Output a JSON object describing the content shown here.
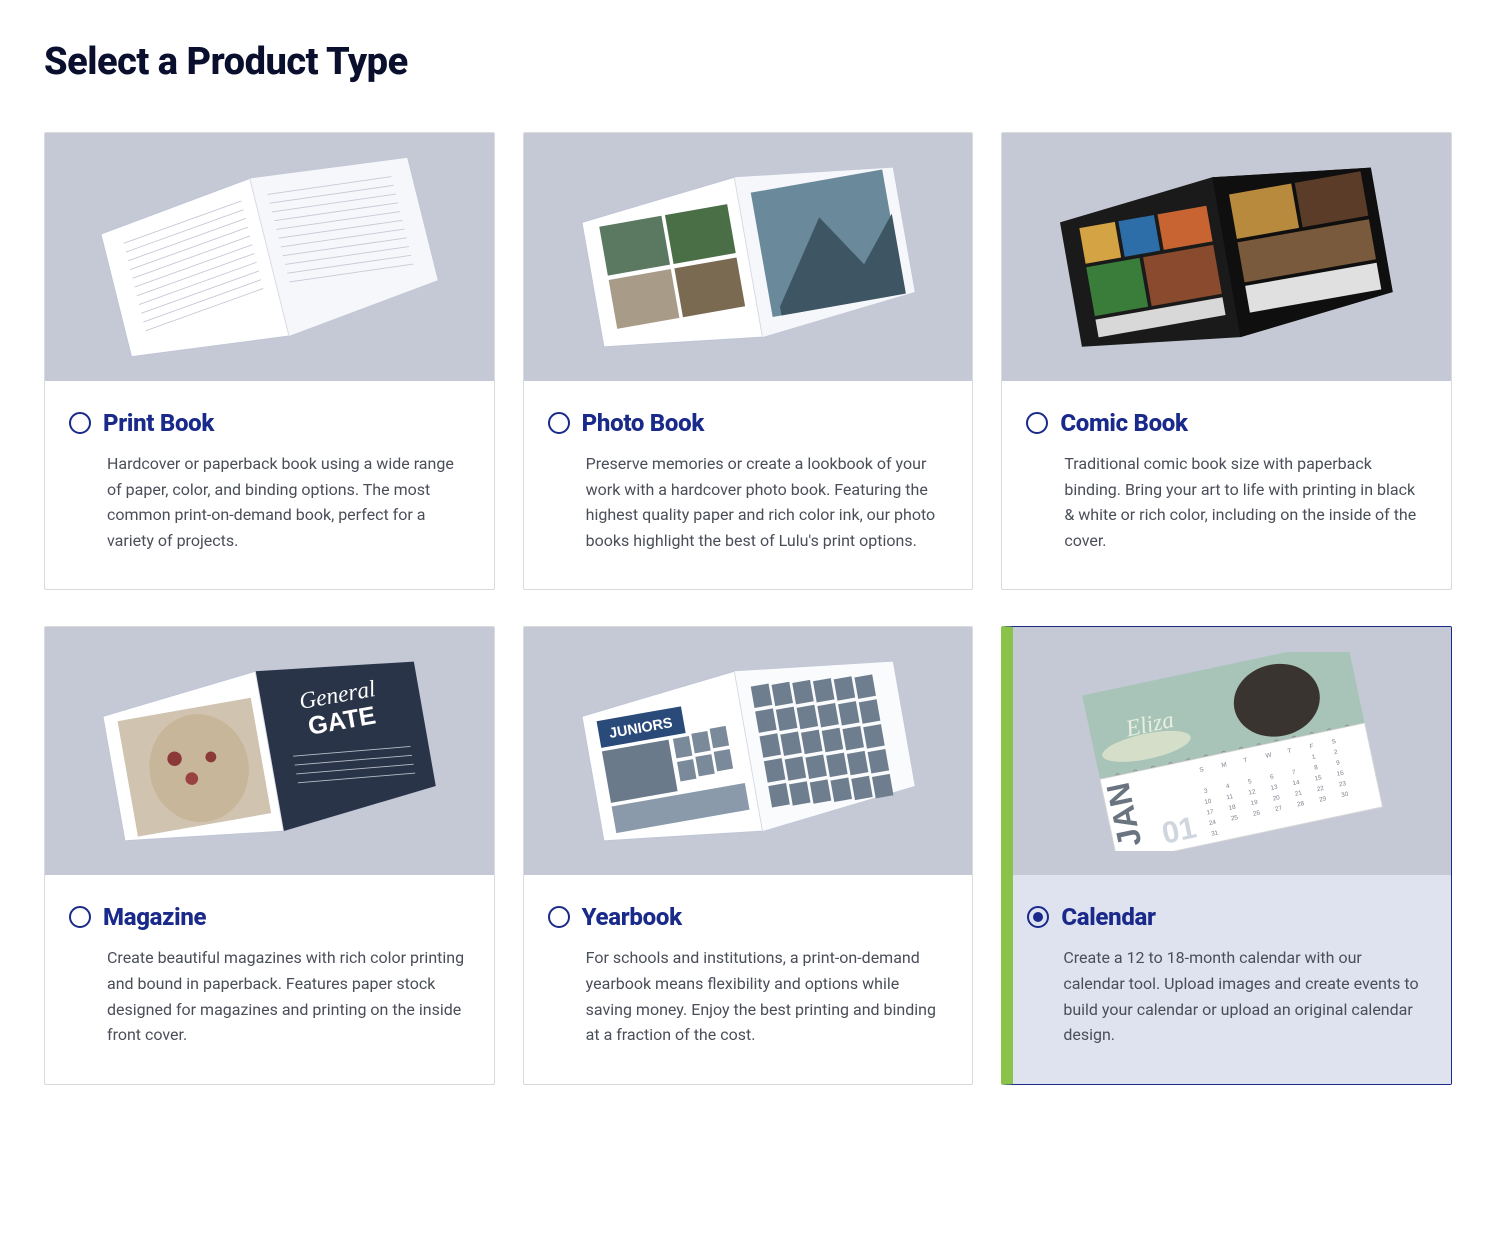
{
  "page": {
    "title": "Select a Product Type"
  },
  "products": [
    {
      "id": "print-book",
      "title": "Print Book",
      "description": "Hardcover or paperback book using a wide range of paper, color, and binding options. The most common print-on-demand book, perfect for a variety of projects.",
      "selected": false
    },
    {
      "id": "photo-book",
      "title": "Photo Book",
      "description": "Preserve memories or create a lookbook of your work with a hardcover photo book. Featuring the highest quality paper and rich color ink, our photo books highlight the best of Lulu's print options.",
      "selected": false
    },
    {
      "id": "comic-book",
      "title": "Comic Book",
      "description": "Traditional comic book size with paperback binding. Bring your art to life with printing in black & white or rich color, including on the inside of the cover.",
      "selected": false
    },
    {
      "id": "magazine",
      "title": "Magazine",
      "description": "Create beautiful magazines with rich color printing and bound in paperback. Features paper stock designed for magazines and printing on the inside front cover.",
      "selected": false
    },
    {
      "id": "yearbook",
      "title": "Yearbook",
      "description": "For schools and institutions, a print-on-demand yearbook means flexibility and options while saving money. Enjoy the best printing and binding at a fraction of the cost.",
      "selected": false
    },
    {
      "id": "calendar",
      "title": "Calendar",
      "description": "Create a 12 to 18-month calendar with our calendar tool. Upload images and create events to build your calendar or upload an original calendar design.",
      "selected": true
    }
  ]
}
